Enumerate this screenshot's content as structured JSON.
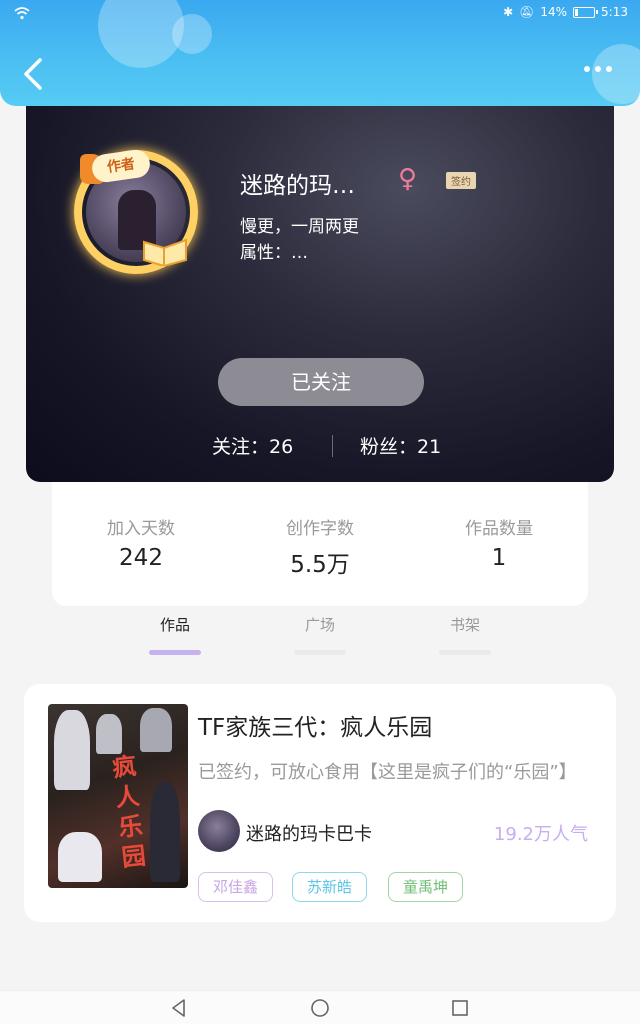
{
  "status_bar": {
    "battery": "14%",
    "battery_level": 0.14,
    "time": "5:13"
  },
  "header": {
    "back_icon": "chevron-left-icon",
    "more_icon": "more-dots-icon"
  },
  "profile": {
    "author_badge": "作者",
    "username": "迷路的玛…",
    "gender_symbol": "♀",
    "signed_tag": "签约",
    "bio": "慢更，一周两更",
    "attributes": "属性：…",
    "follow_button": "已关注",
    "following": "关注：26",
    "fans": "粉丝：21"
  },
  "stats": [
    {
      "label": "加入天数",
      "value": "242"
    },
    {
      "label": "创作字数",
      "value": "5.5万"
    },
    {
      "label": "作品数量",
      "value": "1"
    }
  ],
  "tabs": [
    {
      "label": "作品",
      "active": true
    },
    {
      "label": "广场",
      "active": false
    },
    {
      "label": "书架",
      "active": false
    }
  ],
  "book": {
    "title": "TF家族三代：疯人乐园",
    "cover_title": "疯人乐园",
    "description": "已签约，可放心食用【这里是疯子们的“乐园”】",
    "author": "迷路的玛卡巴卡",
    "popularity": "19.2万人气",
    "tags": [
      "邓佳鑫",
      "苏新皓",
      "童禹坤"
    ]
  },
  "nav": {
    "back": "nav-back-icon",
    "home": "nav-home-icon",
    "recents": "nav-recents-icon"
  },
  "colors": {
    "header": "#4cc0f2",
    "accent": "#c6b2f0",
    "female": "#f07a9a"
  }
}
